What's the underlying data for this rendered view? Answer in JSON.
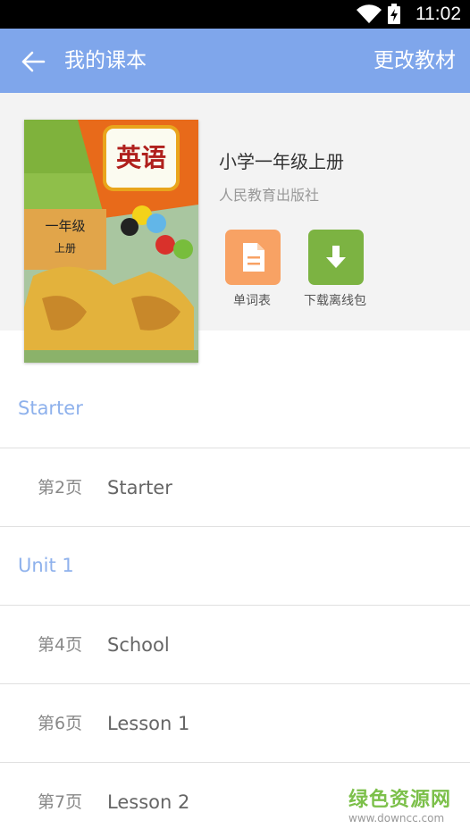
{
  "status_bar": {
    "time": "11:02"
  },
  "header": {
    "title": "我的课本",
    "action": "更改教材"
  },
  "book": {
    "title": "小学一年级上册",
    "publisher": "人民教育出版社",
    "cover": {
      "title": "英语",
      "grade": "一年级",
      "volume": "上册"
    }
  },
  "buttons": {
    "wordlist_label": "单词表",
    "download_label": "下载离线包"
  },
  "sections": [
    {
      "label": "Starter",
      "items": [
        {
          "page": "第2页",
          "name": "Starter"
        }
      ]
    },
    {
      "label": "Unit 1",
      "items": [
        {
          "page": "第4页",
          "name": "School"
        },
        {
          "page": "第6页",
          "name": "Lesson 1"
        },
        {
          "page": "第7页",
          "name": "Lesson 2"
        }
      ]
    }
  ],
  "watermark": {
    "main": "绿色资源网",
    "url": "www.downcc.com"
  },
  "colors": {
    "appbar": "#7fa6eb",
    "section_text": "#8eb1ec",
    "wordlist_button": "#f8a264",
    "download_button": "#7cb342"
  }
}
